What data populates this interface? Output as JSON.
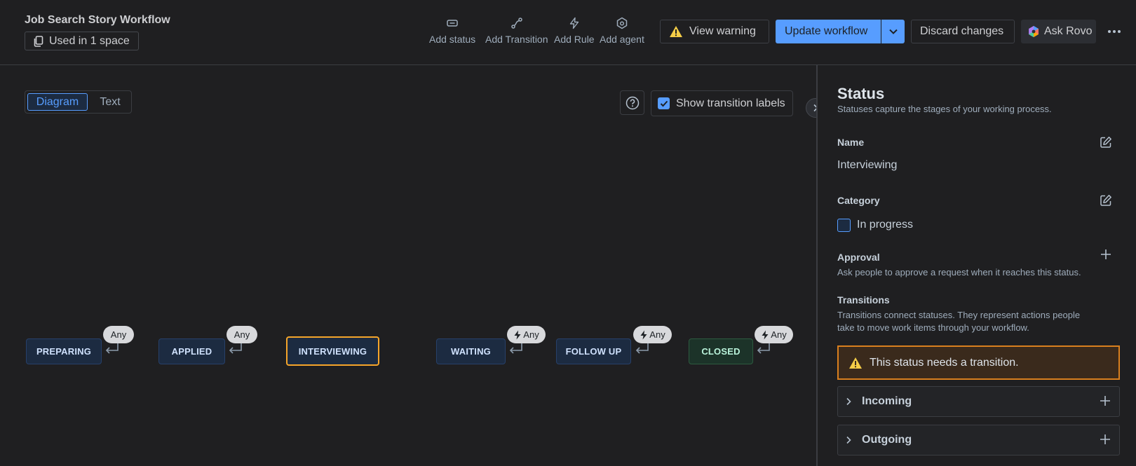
{
  "header": {
    "title": "Job Search Story Workflow",
    "used_in": "Used in 1 space",
    "tools": {
      "add_status": "Add status",
      "add_transition": "Add Transition",
      "add_rule": "Add Rule",
      "add_agent": "Add agent"
    },
    "view_warning": "View warning",
    "update_workflow": "Update workflow",
    "discard_changes": "Discard changes",
    "ask_rovo": "Ask Rovo"
  },
  "canvas": {
    "tabs": {
      "diagram": "Diagram",
      "text": "Text"
    },
    "show_labels": "Show transition labels",
    "show_labels_checked": true,
    "statuses": [
      {
        "label": "PREPARING",
        "any": "Any",
        "rule_icon": false
      },
      {
        "label": "APPLIED",
        "any": "Any",
        "rule_icon": false
      },
      {
        "label": "INTERVIEWING",
        "selected": true
      },
      {
        "label": "WAITING",
        "any": "Any",
        "rule_icon": true
      },
      {
        "label": "FOLLOW UP",
        "any": "Any",
        "rule_icon": true
      },
      {
        "label": "CLOSED",
        "any": "Any",
        "rule_icon": true
      }
    ]
  },
  "panel": {
    "title": "Status",
    "subtitle": "Statuses capture the stages of your working process.",
    "name_label": "Name",
    "name_value": "Interviewing",
    "category_label": "Category",
    "category_value": "In progress",
    "approval_label": "Approval",
    "approval_desc": "Ask people to approve a request when it reaches this status.",
    "transitions_label": "Transitions",
    "transitions_desc_1": "Transitions connect statuses. They represent actions people",
    "transitions_desc_2": "take to move work items through your workflow.",
    "warning": "This status needs a transition.",
    "incoming": "Incoming",
    "outgoing": "Outgoing"
  },
  "colors": {
    "accent": "#579dff",
    "warning": "#f5a52a",
    "background": "#1f1f21"
  }
}
